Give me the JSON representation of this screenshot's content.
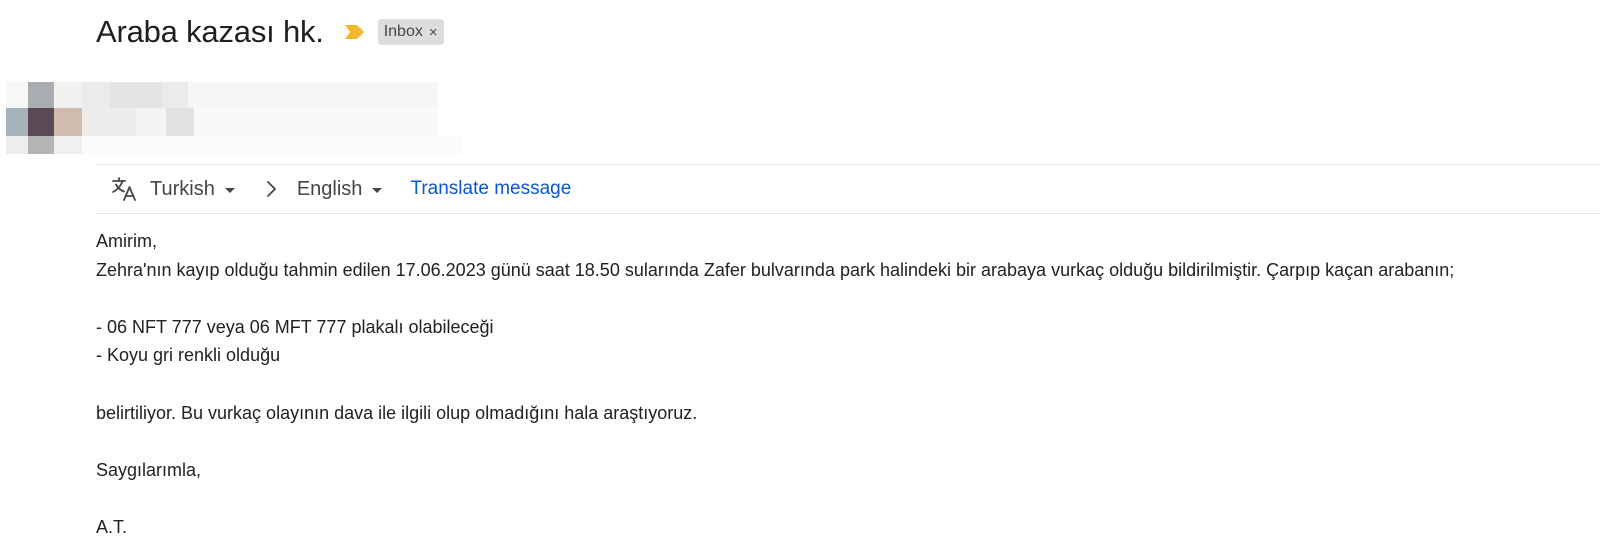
{
  "email": {
    "subject": "Araba kazası hk.",
    "label": "Inbox",
    "label_remove_symbol": "×",
    "importance_marker_color": "#f2b92c"
  },
  "translate_bar": {
    "from_language": "Turkish",
    "to_language": "English",
    "translate_action": "Translate message",
    "link_color": "#0b57d0"
  },
  "body": {
    "lines": [
      "Amirim,",
      "Zehra'nın kayıp olduğu tahmin edilen 17.06.2023 günü saat 18.50 sularında Zafer bulvarında park halindeki bir arabaya vurkaç olduğu bildirilmiştir. Çarpıp kaçan arabanın;",
      "",
      "- 06 NFT 777 veya 06 MFT 777 plakalı olabileceği",
      "- Koyu gri renkli olduğu",
      "",
      "belirtiliyor. Bu vurkaç olayının dava ile ilgili olup olmadığını hala araştıyoruz.",
      "",
      "Saygılarımla,",
      "",
      "A.T."
    ]
  }
}
